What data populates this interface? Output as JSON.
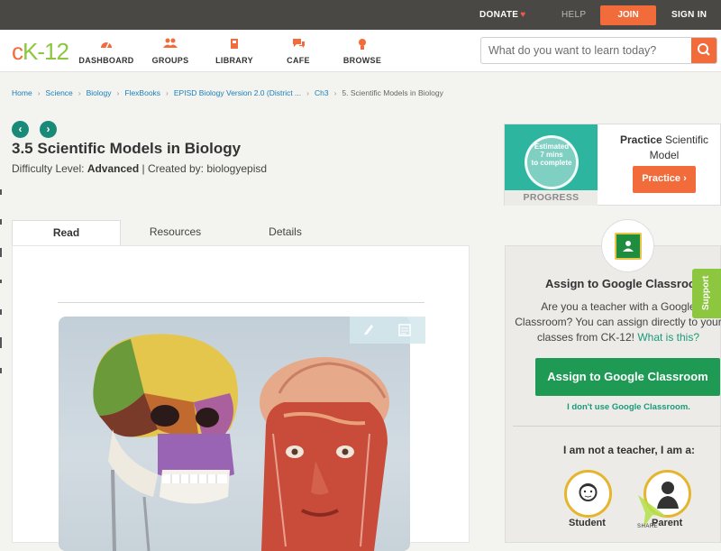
{
  "topbar": {
    "donate": "DONATE",
    "help": "HELP",
    "join": "JOIN",
    "signin": "SIGN IN"
  },
  "nav": {
    "logo": {
      "c": "c",
      "k": "K",
      "dash": "-",
      "num": "12"
    },
    "items": [
      {
        "label": "DASHBOARD",
        "icon": "dashboard-icon"
      },
      {
        "label": "GROUPS",
        "icon": "groups-icon"
      },
      {
        "label": "LIBRARY",
        "icon": "library-icon"
      },
      {
        "label": "CAFE",
        "icon": "cafe-icon"
      },
      {
        "label": "BROWSE",
        "icon": "browse-icon"
      }
    ],
    "search_placeholder": "What do you want to learn today?"
  },
  "breadcrumb": [
    "Home",
    "Science",
    "Biology",
    "FlexBooks",
    "EPISD Biology Version 2.0 (District ...",
    "Ch3",
    "5. Scientific Models in Biology"
  ],
  "page": {
    "title": "3.5 Scientific Models in Biology",
    "difficulty_label": "Difficulty Level: ",
    "difficulty_value": "Advanced",
    "created_by": " | Created by: biologyepisd"
  },
  "tabs": [
    "Read",
    "Resources",
    "Details"
  ],
  "practice": {
    "estimated": "Estimated",
    "mins": "7 mins",
    "to_complete": "to complete",
    "progress_label": "PROGRESS",
    "title_bold": "Practice",
    "title_rest": " Scientific Model",
    "button": "Practice"
  },
  "assign": {
    "title": "Assign to Google Classroom",
    "text": "Are you a teacher with a Google Classroom? You can assign directly to your classes from CK-12!",
    "link": "What is this?",
    "button": "Assign to Google Classroom",
    "dont_use": "I don't use Google Classroom.",
    "not_teacher": "I am not a teacher, I am a:",
    "roles": [
      "Student",
      "Parent"
    ]
  },
  "support": "Support",
  "share": "SHARE",
  "colors": {
    "accent": "#f26b3a",
    "teal": "#1a8a78",
    "green": "#1e9a54",
    "lime": "#8dc63f",
    "link": "#1b7fb8"
  }
}
